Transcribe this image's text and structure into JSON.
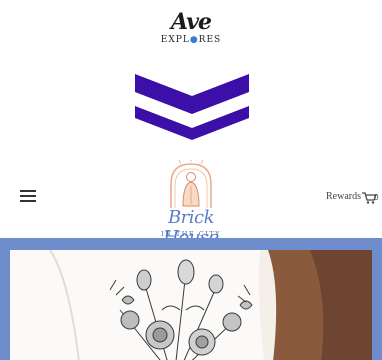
{
  "brand_top": {
    "script": "Ave",
    "tagline_before": "EXPL",
    "tagline_dot": "●",
    "tagline_after": "RES"
  },
  "colors": {
    "chevron": "#3b0fa8",
    "brick_blue": "#5b7cc8",
    "hero_blue": "#6f8ccc"
  },
  "header": {
    "menu_icon": "hamburger-menu-icon",
    "logo_title": "Brick House",
    "logo_subtitle": "IN THE CITY",
    "rewards_label": "Rewards",
    "cart_icon": "shopping-cart-icon",
    "cart_count": "0"
  },
  "hero": {
    "image_subject": "white t-shirt with vintage floral bouquet print"
  }
}
